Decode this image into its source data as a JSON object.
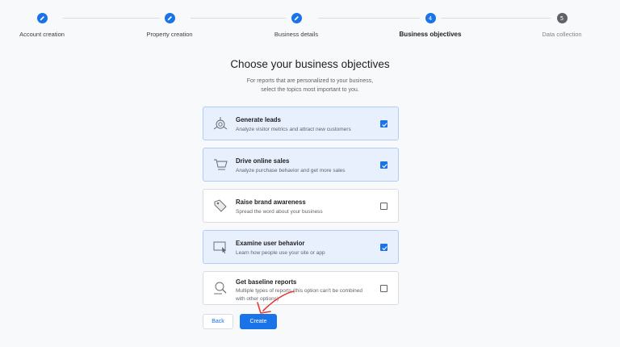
{
  "stepper": {
    "steps": [
      {
        "label": "Account creation",
        "status": "done",
        "number": ""
      },
      {
        "label": "Property creation",
        "status": "done",
        "number": ""
      },
      {
        "label": "Business details",
        "status": "done",
        "number": ""
      },
      {
        "label": "Business objectives",
        "status": "active",
        "number": "4"
      },
      {
        "label": "Data collection",
        "status": "todo",
        "number": "5"
      }
    ]
  },
  "main": {
    "title": "Choose your business objectives",
    "subtitle_line1": "For reports that are personalized to your business,",
    "subtitle_line2": "select the topics most important to you."
  },
  "objectives": [
    {
      "name": "Generate leads",
      "description": "Analyze visitor metrics and attract new customers",
      "checked": true,
      "icon": "target-icon"
    },
    {
      "name": "Drive online sales",
      "description": "Analyze purchase behavior and get more sales",
      "checked": true,
      "icon": "cart-icon"
    },
    {
      "name": "Raise brand awareness",
      "description": "Spread the word about your business",
      "checked": false,
      "icon": "tag-icon"
    },
    {
      "name": "Examine user behavior",
      "description": "Learn how people use your site or app",
      "checked": true,
      "icon": "monitor-cursor-icon"
    },
    {
      "name": "Get baseline reports",
      "description": "Multiple types of reports (this option can't be combined with other options)",
      "checked": false,
      "icon": "magnifier-chart-icon"
    }
  ],
  "actions": {
    "back_label": "Back",
    "create_label": "Create"
  },
  "colors": {
    "accent": "#1a73e8",
    "checked_card_bg": "#e8f0fe",
    "annotation": "#e53935"
  }
}
